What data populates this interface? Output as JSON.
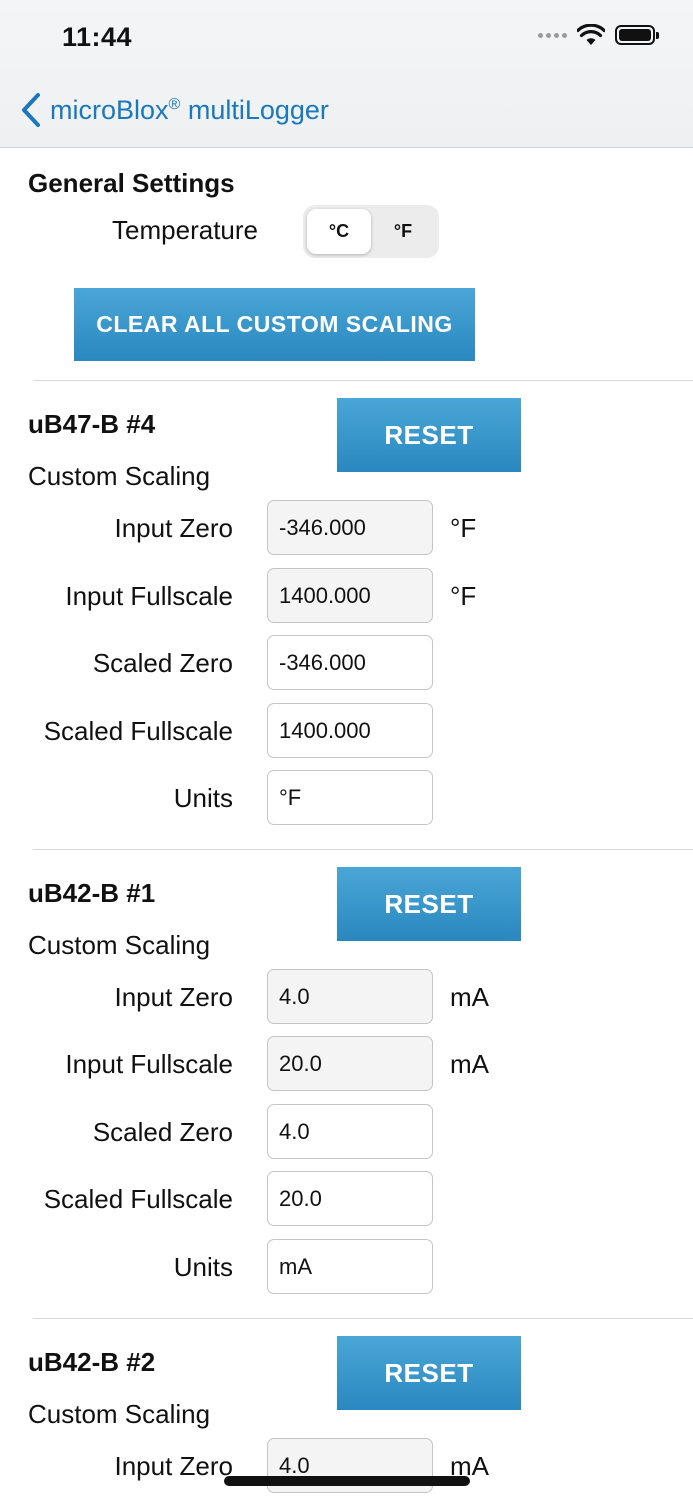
{
  "status": {
    "time": "11:44"
  },
  "nav": {
    "back_label": "microBlox",
    "back_reg": "®",
    "back_suffix": " multiLogger"
  },
  "general": {
    "title": "General Settings",
    "temperature_label": "Temperature",
    "unit_options": [
      "°C",
      "°F"
    ],
    "selected_unit": "°C",
    "clear_button": "CLEAR ALL CUSTOM SCALING"
  },
  "devices": [
    {
      "name": "uB47-B #4",
      "reset": "RESET",
      "custom_scaling": "Custom Scaling",
      "fields": [
        {
          "label": "Input Zero",
          "value": "-346.000",
          "unit": "°F"
        },
        {
          "label": "Input Fullscale",
          "value": "1400.000",
          "unit": "°F"
        },
        {
          "label": "Scaled Zero",
          "value": "-346.000",
          "unit": ""
        },
        {
          "label": "Scaled Fullscale",
          "value": "1400.000",
          "unit": ""
        },
        {
          "label": "Units",
          "value": "°F",
          "unit": ""
        }
      ]
    },
    {
      "name": "uB42-B #1",
      "reset": "RESET",
      "custom_scaling": "Custom Scaling",
      "fields": [
        {
          "label": "Input Zero",
          "value": "4.0",
          "unit": "mA"
        },
        {
          "label": "Input Fullscale",
          "value": "20.0",
          "unit": "mA"
        },
        {
          "label": "Scaled Zero",
          "value": "4.0",
          "unit": ""
        },
        {
          "label": "Scaled Fullscale",
          "value": "20.0",
          "unit": ""
        },
        {
          "label": "Units",
          "value": "mA",
          "unit": ""
        }
      ]
    },
    {
      "name": "uB42-B #2",
      "reset": "RESET",
      "custom_scaling": "Custom Scaling",
      "fields": [
        {
          "label": "Input Zero",
          "value": "4.0",
          "unit": "mA"
        }
      ]
    }
  ],
  "colors": {
    "accent": "#1a78be",
    "button": "#2a88c0"
  }
}
